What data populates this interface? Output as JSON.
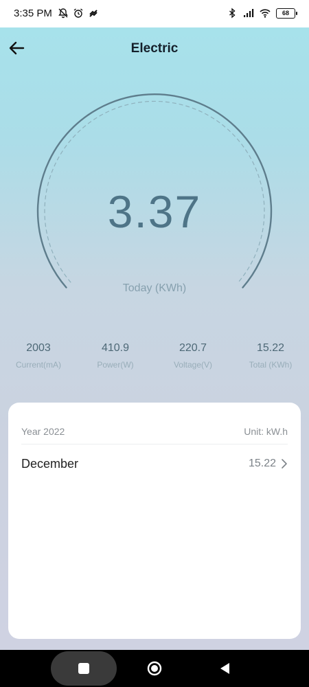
{
  "status_bar": {
    "time": "3:35 PM",
    "battery": "68",
    "icons": [
      "bell-off-icon",
      "alarm-icon",
      "hotspot-icon",
      "bluetooth-icon",
      "signal-icon",
      "wifi-icon",
      "battery-icon"
    ]
  },
  "header": {
    "title": "Electric",
    "back_icon": "arrow-left-icon"
  },
  "gauge": {
    "value": "3.37",
    "caption": "Today (KWh)"
  },
  "stats": [
    {
      "value": "2003",
      "label": "Current(mA)"
    },
    {
      "value": "410.9",
      "label": "Power(W)"
    },
    {
      "value": "220.7",
      "label": "Voltage(V)"
    },
    {
      "value": "15.22",
      "label": "Total (KWh)"
    }
  ],
  "history": {
    "year_label": "Year 2022",
    "unit_label": "Unit: kW.h",
    "months": [
      {
        "name": "December",
        "value": "15.22"
      }
    ]
  },
  "colors": {
    "accent": "#4e7487",
    "gradient_top": "#a6e3ec",
    "gradient_bottom": "#cfd2e2"
  },
  "nav_bar": {
    "icons": [
      "recents-icon",
      "home-icon",
      "back-triangle-icon"
    ]
  }
}
